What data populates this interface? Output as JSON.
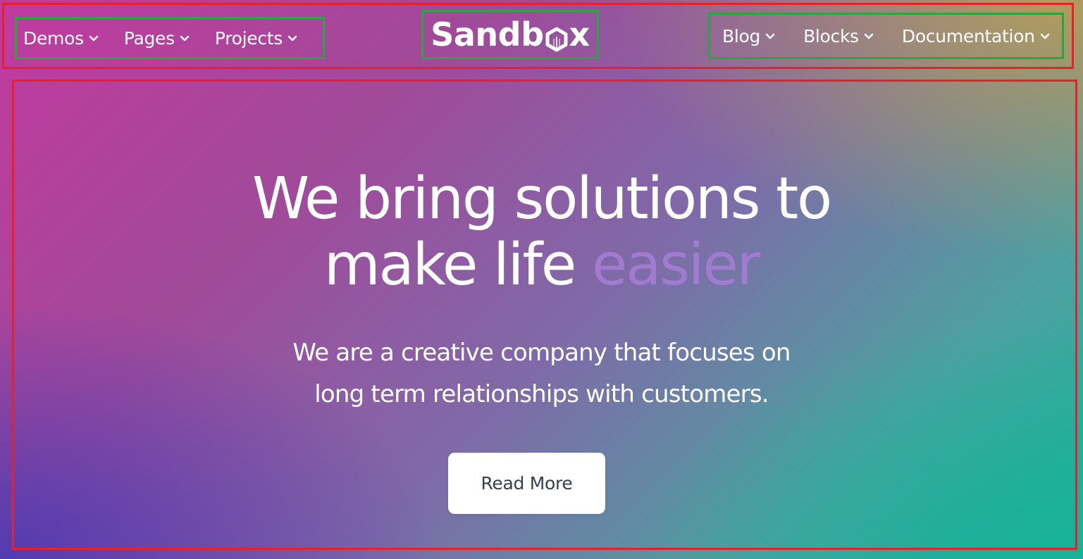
{
  "header": {
    "nav_left": [
      {
        "label": "Demos"
      },
      {
        "label": "Pages"
      },
      {
        "label": "Projects"
      }
    ],
    "logo_text_start": "Sandb",
    "logo_text_end": "x",
    "nav_right": [
      {
        "label": "Blog"
      },
      {
        "label": "Blocks"
      },
      {
        "label": "Documentation"
      }
    ]
  },
  "hero": {
    "title_line1": "We bring solutions to",
    "title_line2_plain": "make life ",
    "title_line2_accent": "easier",
    "subtitle_line1": "We are a creative company that focuses on",
    "subtitle_line2": "long term relationships with customers.",
    "cta_label": "Read More"
  },
  "colors": {
    "accent_word": "#a07bd0",
    "button_text": "#343f52",
    "annotation_red": "#e8202a",
    "annotation_green": "#2aa640"
  },
  "icons": {
    "dropdown": "chevron-down-icon",
    "logo_mark": "box-logo-icon"
  }
}
